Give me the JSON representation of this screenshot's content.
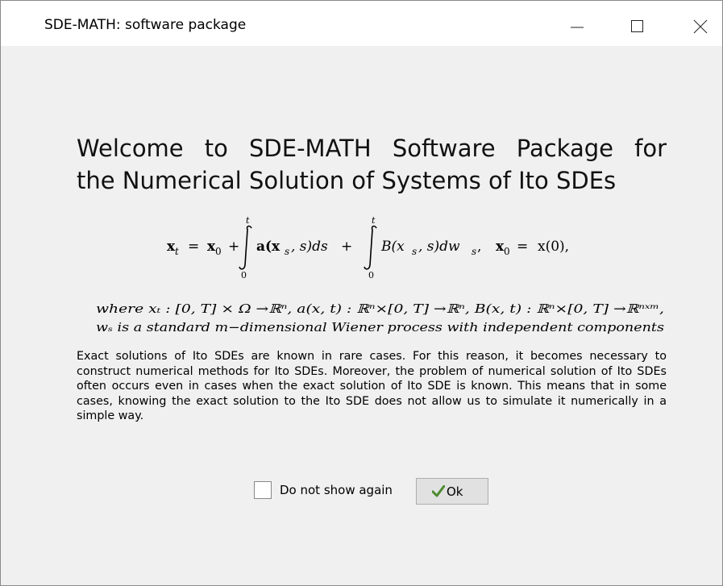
{
  "window": {
    "title": "SDE-MATH: software package",
    "controls": {
      "minimize": "minimize-icon",
      "maximize": "maximize-icon",
      "close": "close-icon"
    }
  },
  "heading": {
    "line1": "Welcome to SDE-MATH Software Package for",
    "line2": "the Numerical Solution of Systems of Ito SDEs"
  },
  "formula": {
    "lhs": "x",
    "lhs_sub": "t",
    "eq1": "=",
    "x0": "x",
    "x0_sub": "0",
    "plus1": "+",
    "int1_upper": "t",
    "int1_lower": "0",
    "integrand1": "a(x",
    "integrand1_sub": "s",
    "integrand1_tail": ", s)ds",
    "plus2": "+",
    "int2_upper": "t",
    "int2_lower": "0",
    "integrand2": "B(x",
    "integrand2_sub": "s",
    "integrand2_tail": ", s)dw",
    "integrand2_tail_sub": "s",
    "comma": ",",
    "init_lhs": "x",
    "init_lhs_sub": "0",
    "eq2": "=",
    "init_rhs": "x(0),"
  },
  "where_block": {
    "line1": "where xₜ : [0, T] × Ω →ℝⁿ,  a(x, t) :  ℝⁿ×[0, T] →ℝⁿ,  B(x, t) :  ℝⁿ×[0, T] →ℝⁿˣᵐ,",
    "line2": "wₛ is a standard m−dimensional Wiener process with independent components"
  },
  "paragraph": "Exact solutions of Ito SDEs are known in rare cases. For this reason, it becomes necessary to construct numerical methods for Ito SDEs. Moreover, the problem of numerical solution of Ito SDEs often occurs even in cases when the exact solution of Ito SDE is known. This means that in some cases, knowing the exact solution to the Ito SDE does not allow us to simulate it numerically in a simple way.",
  "footer": {
    "checkbox_label": "Do not show again",
    "checkbox_checked": false,
    "ok_label": "Ok",
    "ok_icon": "checkmark-icon",
    "ok_icon_color": "#4c8a2e"
  }
}
